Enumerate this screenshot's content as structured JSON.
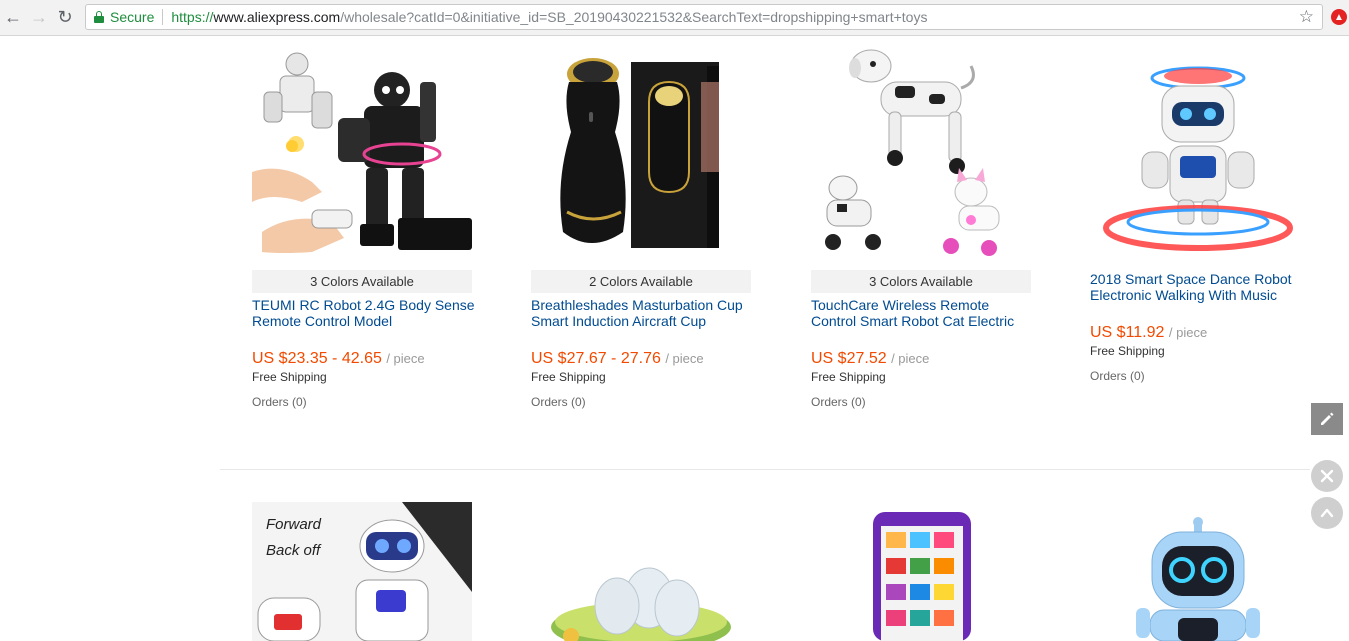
{
  "browser": {
    "back_icon": "arrow-left-icon",
    "forward_icon": "arrow-right-icon",
    "reload_icon": "reload-icon",
    "security_label": "Secure",
    "url_scheme": "https://",
    "url_host": "www.aliexpress.com",
    "url_path": "/wholesale?catId=0&initiative_id=SB_20190430221532&SearchText=dropshipping+smart+toys",
    "bookmark_icon": "star-icon",
    "extension_icon": "extension-icon"
  },
  "colors": {
    "price": "#f24a00",
    "title_link": "#004b91",
    "secure_green": "#1e8e3e"
  },
  "products": [
    {
      "colors_available": "3 Colors Available",
      "title": "TEUMI RC Robot 2.4G Body Sense Remote Control Model",
      "price": "US $23.35 - 42.65",
      "unit": "/ piece",
      "shipping": "Free Shipping",
      "orders": "Orders (0)"
    },
    {
      "colors_available": "2 Colors Available",
      "title": "Breathleshades Masturbation Cup Smart Induction Aircraft Cup",
      "price": "US $27.67 - 27.76",
      "unit": "/ piece",
      "shipping": "Free Shipping",
      "orders": "Orders (0)"
    },
    {
      "colors_available": "3 Colors Available",
      "title": "TouchCare Wireless Remote Control Smart Robot Cat Electric",
      "price": "US $27.52",
      "unit": "/ piece",
      "shipping": "Free Shipping",
      "orders": "Orders (0)"
    },
    {
      "title": "2018 Smart Space Dance Robot Electronic Walking With Music",
      "price": "US $11.92",
      "unit": "/ piece",
      "shipping": "Free Shipping",
      "orders": "Orders (0)"
    }
  ],
  "second_row_images": [
    {
      "overlay_text_1": "Forward",
      "overlay_text_2": "Back off"
    },
    {},
    {},
    {}
  ],
  "floating": {
    "edit_icon": "pencil-icon",
    "close_icon": "close-icon",
    "top_icon": "chevron-up-icon"
  }
}
